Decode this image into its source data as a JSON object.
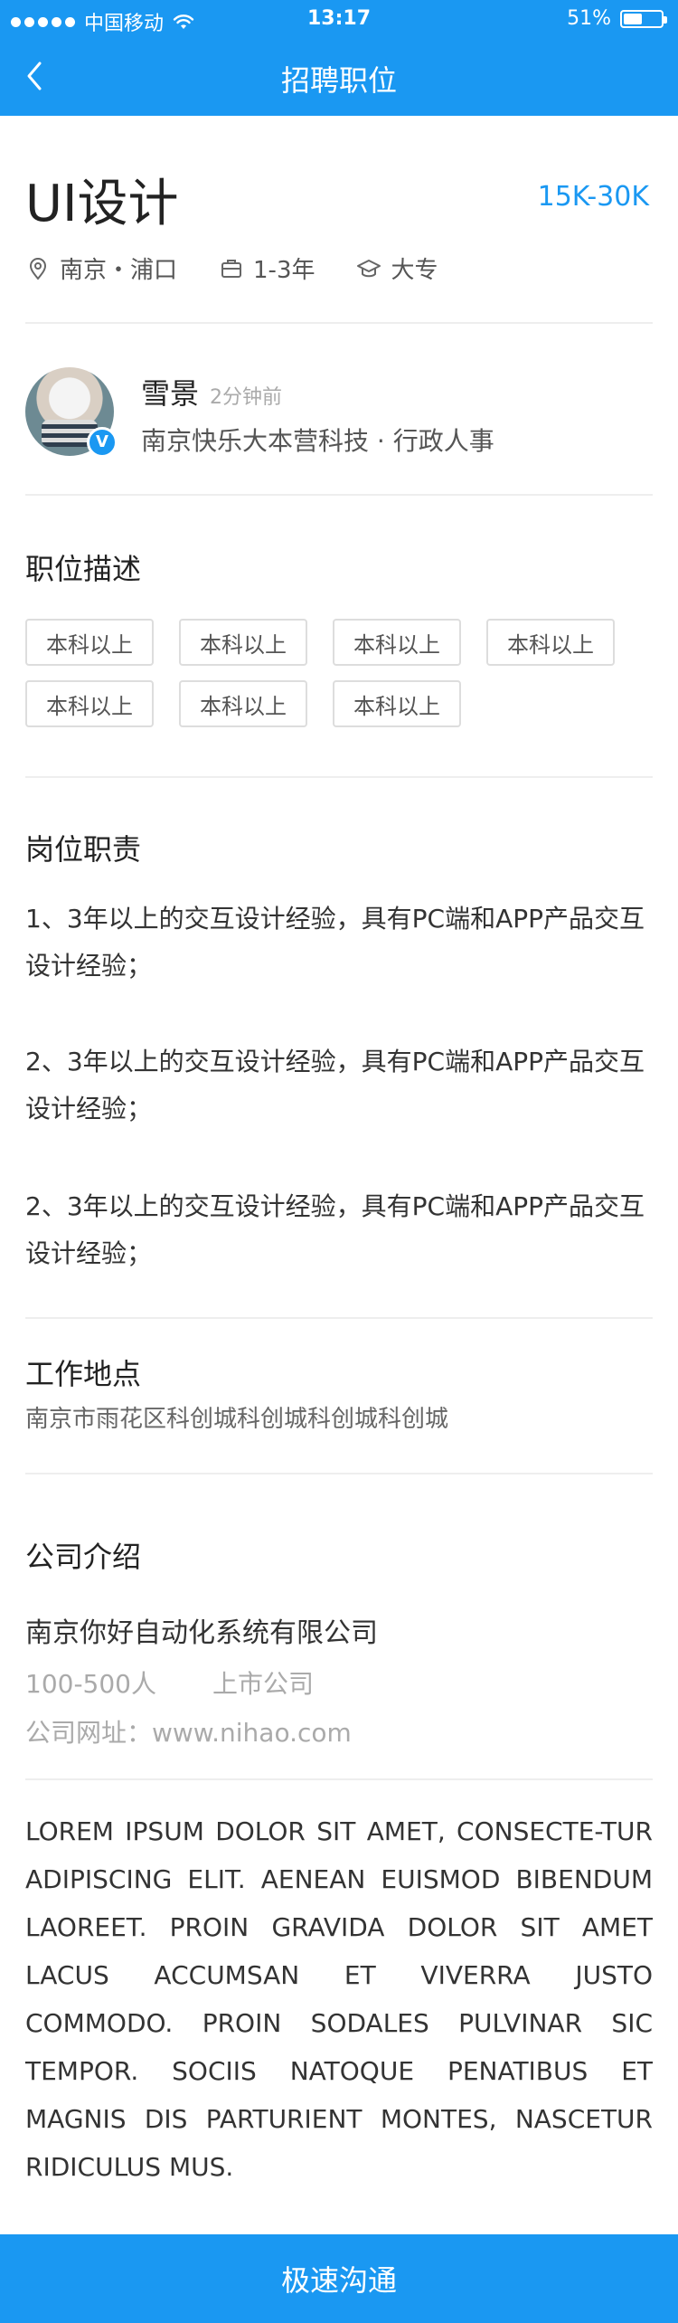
{
  "status_bar": {
    "carrier": "中国移动",
    "time": "13:17",
    "battery_text": "51%",
    "battery_level": 0.51
  },
  "nav": {
    "title": "招聘职位",
    "back_icon": "chevron-left-icon"
  },
  "job": {
    "title": "UI设计",
    "salary": "15K-30K",
    "location": "南京・浦口",
    "experience": "1-3年",
    "education": "大专"
  },
  "recruiter": {
    "name": "雪景",
    "posted_ago": "2分钟前",
    "company_role": "南京快乐大本营科技 · 行政人事",
    "verified_badge": "V"
  },
  "description": {
    "heading": "职位描述",
    "tags": [
      "本科以上",
      "本科以上",
      "本科以上",
      "本科以上",
      "本科以上",
      "本科以上",
      "本科以上"
    ]
  },
  "duties": {
    "heading": "岗位职责",
    "items": [
      "1、3年以上的交互设计经验，具有PC端和APP产品交互设计经验；",
      "2、3年以上的交互设计经验，具有PC端和APP产品交互设计经验；",
      "2、3年以上的交互设计经验，具有PC端和APP产品交互设计经验；"
    ]
  },
  "workplace": {
    "heading": "工作地点",
    "address": "南京市雨花区科创城科创城科创城科创城"
  },
  "company": {
    "heading": "公司介绍",
    "name": "南京你好自动化系统有限公司",
    "size": "100-500人",
    "type": "上市公司",
    "website": "公司网址：www.nihao.com",
    "description": "LOREM IPSUM DOLOR SIT AMET, CONSECTE-TUR ADIPISCING ELIT. AENEAN EUISMOD BIBENDUM LAOREET. PROIN GRAVIDA DOLOR SIT AMET LACUS ACCUMSAN ET VIVERRA JUSTO COMMODO. PROIN SODALES PULVINAR SIC TEMPOR. SOCIIS NATOQUE PENATIBUS ET MAGNIS DIS PARTURIENT MONTES, NASCETUR RIDICULUS MUS."
  },
  "cta": {
    "label": "极速沟通"
  },
  "colors": {
    "brand": "#1a98f2"
  }
}
